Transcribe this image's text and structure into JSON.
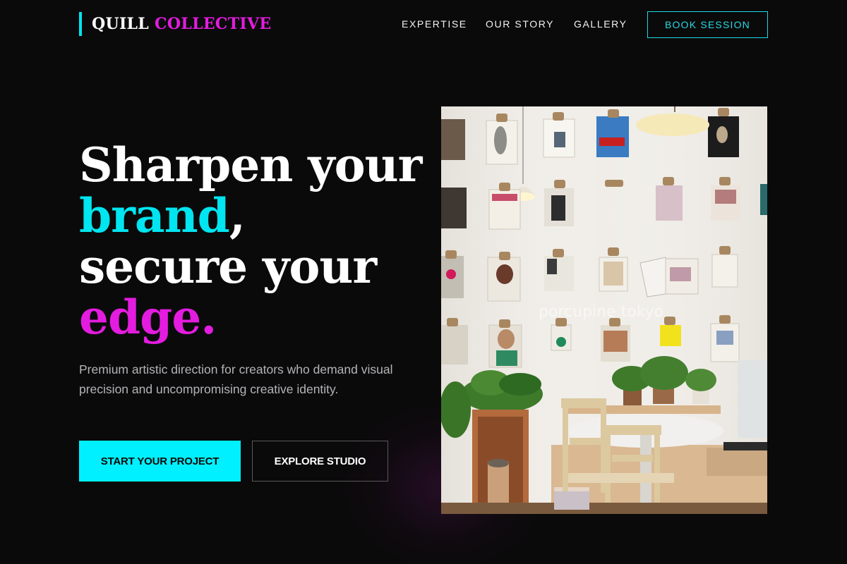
{
  "brand": {
    "word1": "QUILL",
    "word2": "COLLECTIVE"
  },
  "nav": {
    "items": [
      "EXPERTISE",
      "OUR STORY",
      "GALLERY"
    ],
    "cta": "BOOK SESSION"
  },
  "hero": {
    "line1": "Sharpen your",
    "line2_accent": "brand",
    "line2_rest": ",",
    "line3": "secure your",
    "line4_accent": "edge.",
    "subtitle": "Premium artistic direction for creators who demand visual precision and uncompromising creative identity.",
    "primary_button": "START YOUR PROJECT",
    "secondary_button": "EXPLORE STUDIO"
  },
  "photo": {
    "watermark": "porcupine tokyo"
  },
  "colors": {
    "accent_cyan": "#00f0ff",
    "accent_magenta": "#e31ce0",
    "background": "#0a0a0a"
  }
}
